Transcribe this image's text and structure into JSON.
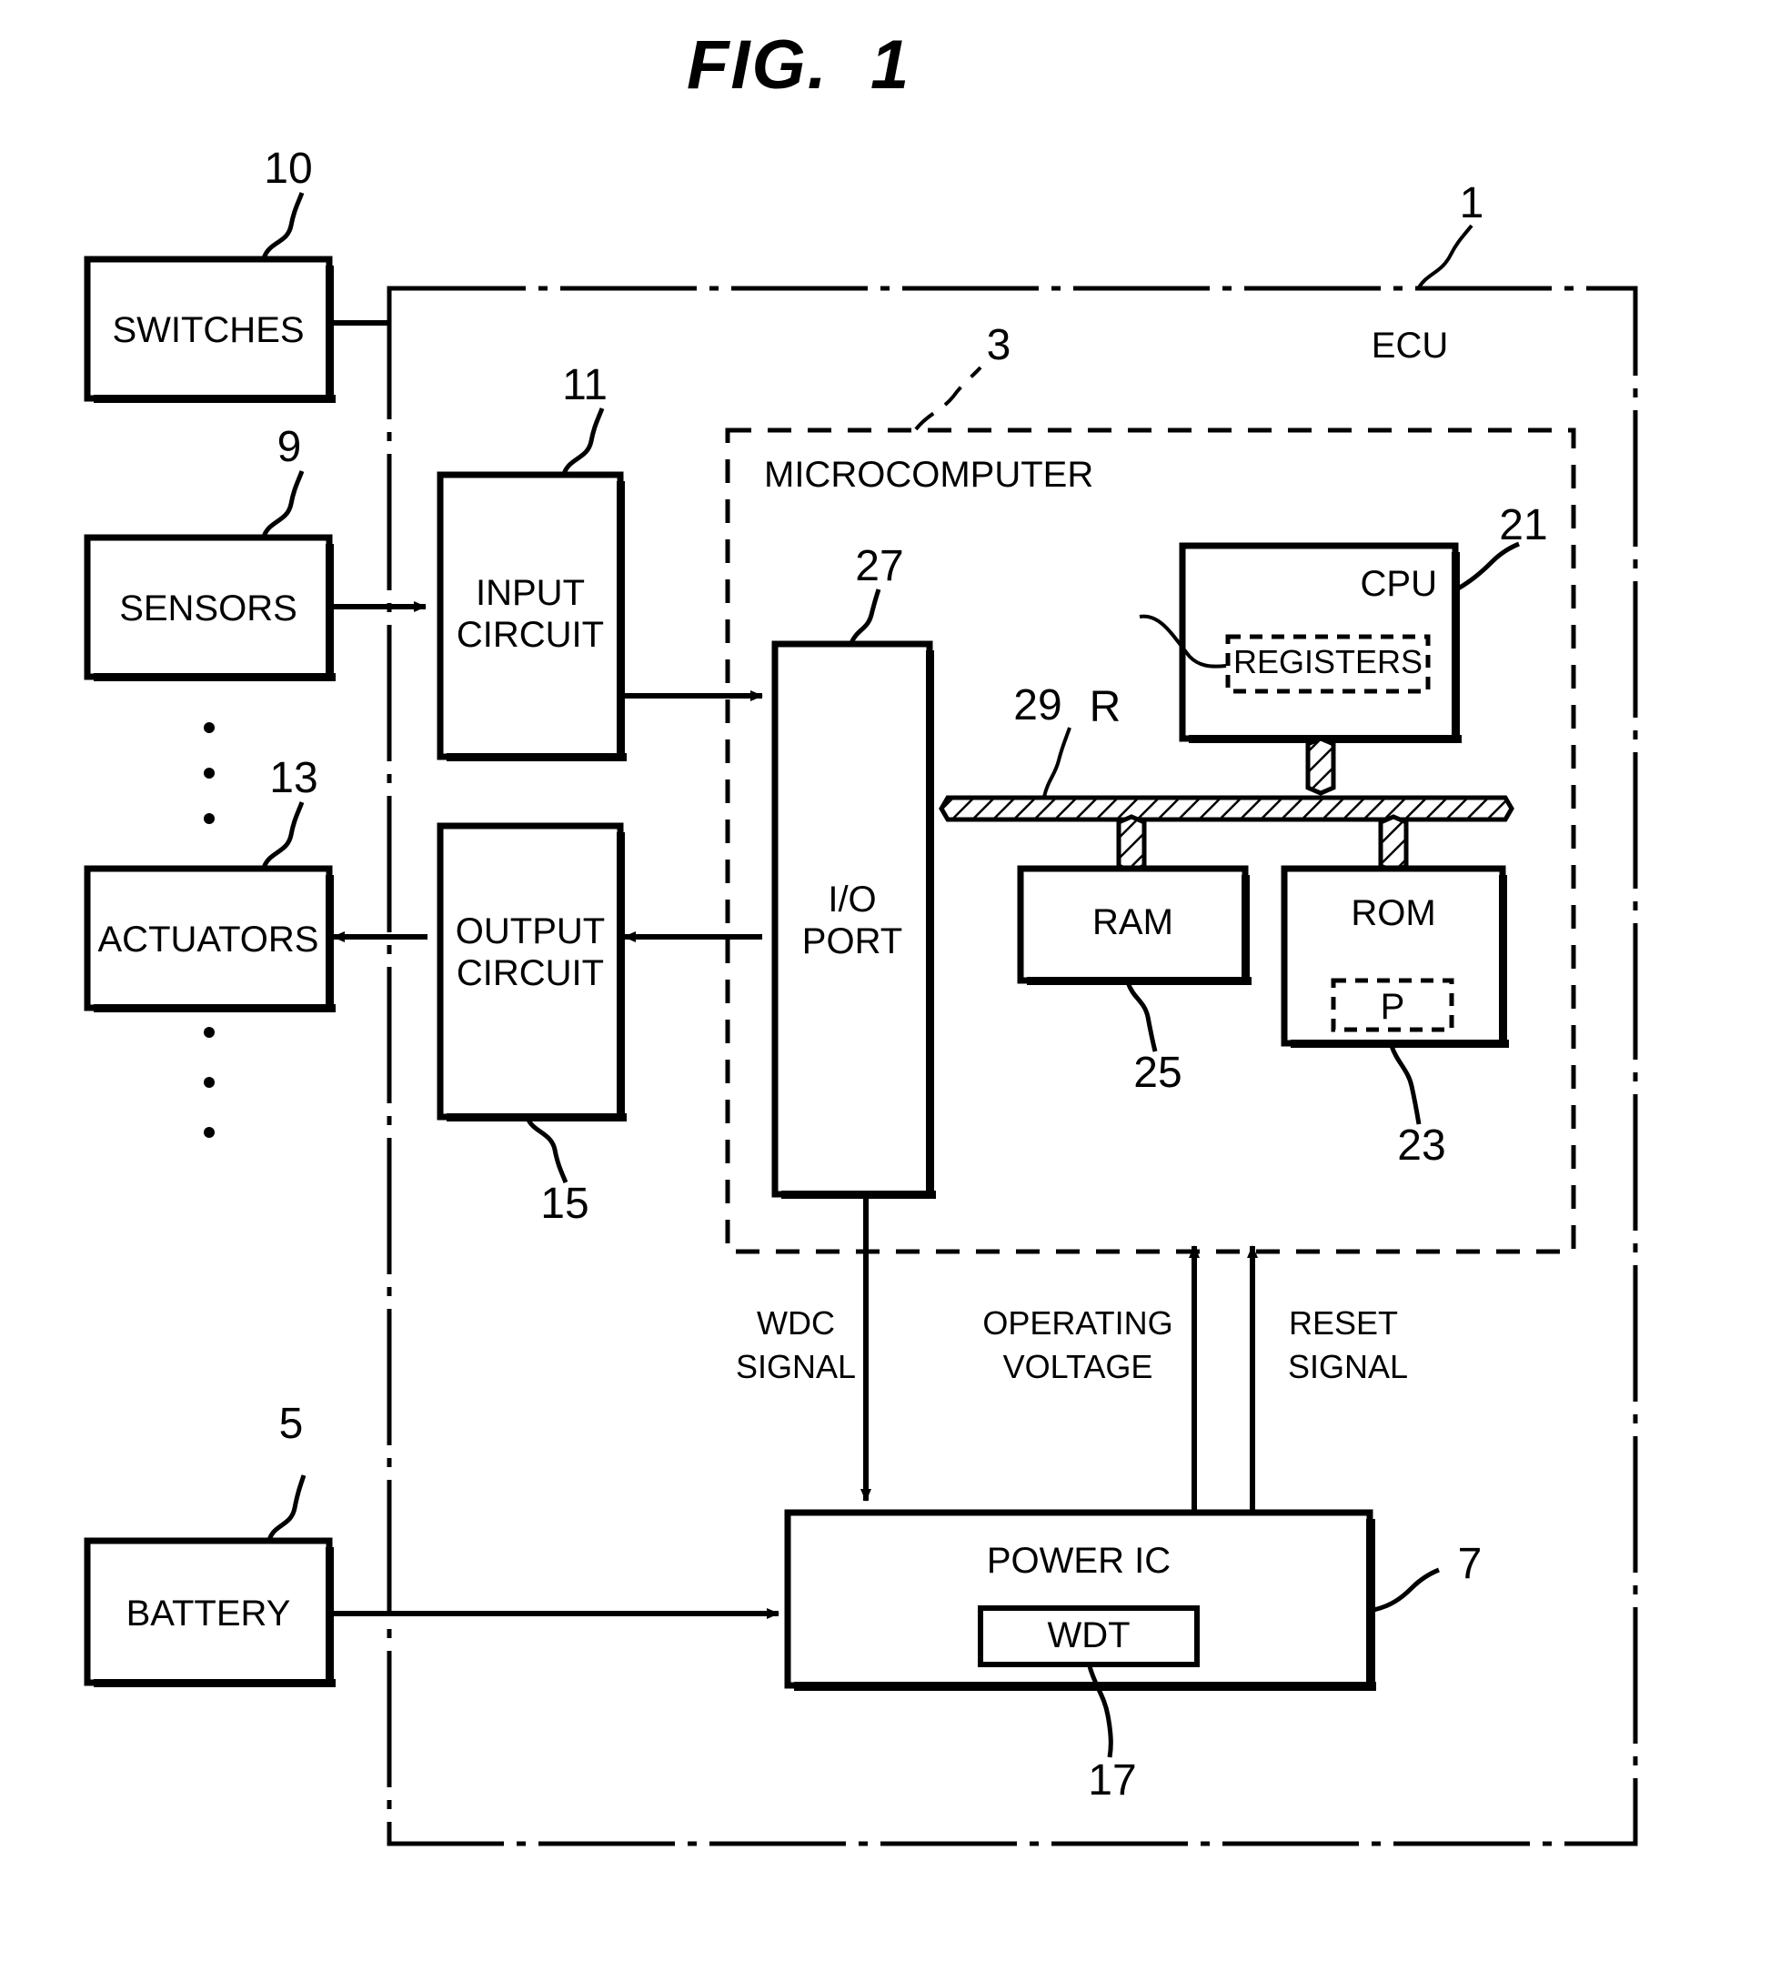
{
  "figure": {
    "title": "FIG.  1",
    "type": "patent-block-diagram"
  },
  "enclosures": {
    "ecu": {
      "label": "ECU",
      "ref": "1",
      "border": "dash-dot"
    },
    "microcomputer": {
      "label": "MICROCOMPUTER",
      "ref": "3",
      "border": "dashed"
    }
  },
  "blocks": {
    "switches": {
      "label": "SWITCHES",
      "ref": "10"
    },
    "sensors": {
      "label": "SENSORS",
      "ref": "9"
    },
    "actuators": {
      "label": "ACTUATORS",
      "ref": "13"
    },
    "input_circuit": {
      "label": "INPUT\nCIRCUIT",
      "line1": "INPUT",
      "line2": "CIRCUIT",
      "ref": "11"
    },
    "output_circuit": {
      "label": "OUTPUT\nCIRCUIT",
      "line1": "OUTPUT",
      "line2": "CIRCUIT",
      "ref": "15"
    },
    "io_port": {
      "line1": "I/O",
      "line2": "PORT",
      "ref": "27"
    },
    "cpu": {
      "label": "CPU",
      "ref": "21"
    },
    "registers": {
      "label": "REGISTERS",
      "ref": "R"
    },
    "bus": {
      "ref": "29"
    },
    "ram": {
      "label": "RAM",
      "ref": "25"
    },
    "rom": {
      "label": "ROM",
      "ref": "23"
    },
    "rom_program": {
      "label": "P"
    },
    "battery": {
      "label": "BATTERY",
      "ref": "5"
    },
    "power_ic": {
      "label": "POWER IC",
      "ref": "7"
    },
    "wdt": {
      "label": "WDT",
      "ref": "17"
    }
  },
  "signals": {
    "wdc": {
      "line1": "WDC",
      "line2": "SIGNAL"
    },
    "operating_voltage": {
      "line1": "OPERATING",
      "line2": "VOLTAGE"
    },
    "reset": {
      "line1": "RESET",
      "line2": "SIGNAL"
    }
  },
  "colors": {
    "ink": "#000000",
    "paper": "#ffffff"
  }
}
